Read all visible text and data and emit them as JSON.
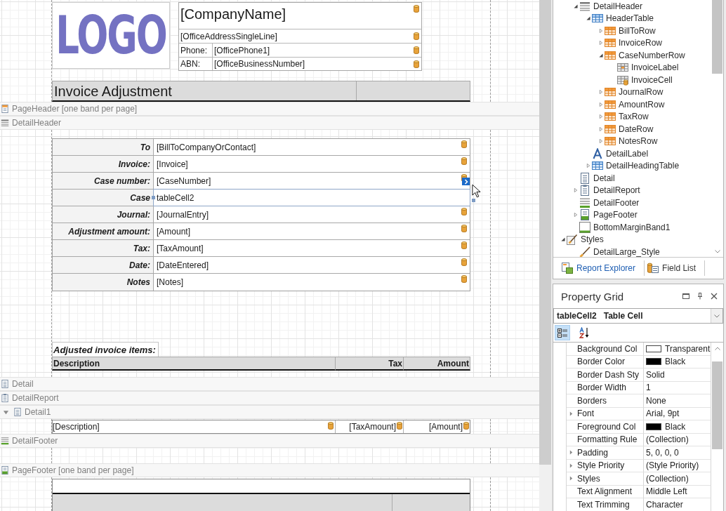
{
  "designer": {
    "header": {
      "logo": "LOGO",
      "company_name": "[CompanyName]",
      "address": "[OfficeAddressSingleLine]",
      "contacts": [
        {
          "label": "Phone:",
          "value": "[OfficePhone1]"
        },
        {
          "label": "ABN:",
          "value": "[OfficeBusinessNumber]"
        }
      ],
      "title": "Invoice Adjustment"
    },
    "header_bands": [
      {
        "label": "PageHeader [one band per page]",
        "kind": "page-header"
      },
      {
        "label": "DetailHeader",
        "kind": "band-header"
      }
    ],
    "fields": [
      {
        "label": "To",
        "value": "[BillToCompanyOrContact]",
        "bound": true,
        "selected": false
      },
      {
        "label": "Invoice:",
        "value": "[Invoice]",
        "bound": true,
        "selected": false
      },
      {
        "label": "Case number:",
        "value": "[CaseNumber]",
        "bound": true,
        "selected": false
      },
      {
        "label": "Case",
        "value": "tableCell2",
        "bound": false,
        "selected": true
      },
      {
        "label": "Journal:",
        "value": "[JournalEntry]",
        "bound": true,
        "selected": false
      },
      {
        "label": "Adjustment amount:",
        "value": "[Amount]",
        "bound": true,
        "selected": false
      },
      {
        "label": "Tax:",
        "value": "[TaxAmount]",
        "bound": true,
        "selected": false
      },
      {
        "label": "Date:",
        "value": "[DateEntered]",
        "bound": true,
        "selected": false
      },
      {
        "label": "Notes",
        "value": "[Notes]",
        "bound": true,
        "selected": false
      }
    ],
    "items_label": "Adjusted invoice items:",
    "columns": [
      "Description",
      "Tax",
      "Amount"
    ],
    "detail_bands": [
      {
        "label": "Detail",
        "kind": "detail"
      },
      {
        "label": "DetailReport",
        "kind": "detail-report"
      },
      {
        "label": "Detail1",
        "kind": "detail",
        "expanded": true
      }
    ],
    "detail_cells": [
      "[Description]",
      "[TaxAmount]",
      "[Amount]"
    ],
    "footer_bands": [
      {
        "label": "DetailFooter",
        "kind": "band-footer"
      },
      {
        "label": "PageFooter [one band per page]",
        "kind": "page-footer"
      }
    ]
  },
  "report_explorer": {
    "tree": [
      {
        "children": [
          {
            "label": "DetailHeader",
            "kind": "band-header",
            "expanded": true,
            "children": [
              {
                "label": "HeaderTable",
                "kind": "table",
                "expanded": true,
                "children": [
                  {
                    "label": "BillToRow",
                    "kind": "table-row",
                    "expanded": false
                  },
                  {
                    "label": "InvoiceRow",
                    "kind": "table-row",
                    "expanded": false
                  },
                  {
                    "label": "CaseNumberRow",
                    "kind": "table-row",
                    "expanded": true,
                    "children": [
                      {
                        "label": "InvoiceLabel",
                        "kind": "cell"
                      },
                      {
                        "label": "InvoiceCell",
                        "kind": "bound-cell"
                      }
                    ]
                  },
                  {
                    "label": "JournalRow",
                    "kind": "table-row",
                    "expanded": false
                  },
                  {
                    "label": "AmountRow",
                    "kind": "table-row",
                    "expanded": false
                  },
                  {
                    "label": "TaxRow",
                    "kind": "table-row",
                    "expanded": false
                  },
                  {
                    "label": "DateRow",
                    "kind": "table-row",
                    "expanded": false
                  },
                  {
                    "label": "NotesRow",
                    "kind": "table-row",
                    "expanded": false
                  }
                ]
              },
              {
                "label": "DetailLabel",
                "kind": "label"
              },
              {
                "label": "DetailHeadingTable",
                "kind": "table",
                "expanded": false
              }
            ]
          },
          {
            "label": "Detail",
            "kind": "detail"
          },
          {
            "label": "DetailReport",
            "kind": "detail-report",
            "expanded": false
          },
          {
            "label": "DetailFooter",
            "kind": "band-footer"
          },
          {
            "label": "PageFooter",
            "kind": "page-footer",
            "expanded": false
          },
          {
            "label": "BottomMarginBand1",
            "kind": "bottom-margin"
          }
        ]
      },
      {
        "label": "Styles",
        "kind": "styles",
        "expanded": true,
        "children": [
          {
            "label": "DetailLarge_Style",
            "kind": "style"
          }
        ]
      }
    ],
    "tabs": [
      {
        "label": "Report Explorer",
        "kind": "explorer",
        "selected": true
      },
      {
        "label": "Field List",
        "kind": "field-list",
        "selected": false
      }
    ]
  },
  "property_grid": {
    "title": "Property Grid",
    "object": {
      "name": "tableCell2",
      "type": "Table Cell"
    },
    "toolbar": [
      {
        "kind": "categorized",
        "selected": true
      },
      {
        "kind": "alphabetical",
        "selected": false
      }
    ],
    "properties": [
      {
        "name": "Background Col",
        "value": "Transparent",
        "color": "#ffffff"
      },
      {
        "name": "Border Color",
        "value": "Black",
        "color": "#000000"
      },
      {
        "name": "Border Dash Sty",
        "value": "Solid"
      },
      {
        "name": "Border Width",
        "value": "1"
      },
      {
        "name": "Borders",
        "value": "None"
      },
      {
        "name": "Font",
        "value": "Arial, 9pt",
        "expanded": false
      },
      {
        "name": "Foreground Col",
        "value": "Black",
        "color": "#000000"
      },
      {
        "name": "Formatting Rule",
        "value": "(Collection)"
      },
      {
        "name": "Padding",
        "value": "5, 0, 0, 0",
        "expanded": false
      },
      {
        "name": "Style Priority",
        "value": "(Style Priority)",
        "expanded": false
      },
      {
        "name": "Styles",
        "value": "(Collection)",
        "expanded": false
      },
      {
        "name": "Text Alignment",
        "value": "Middle Left"
      },
      {
        "name": "Text Trimming",
        "value": "Character"
      }
    ]
  }
}
